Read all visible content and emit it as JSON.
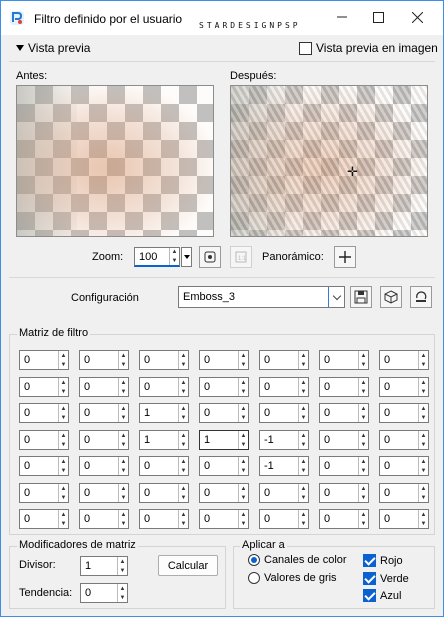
{
  "window": {
    "title": "Filtro definido por el usuario",
    "watermark": "STARDESIGNPSP",
    "accent": "#0a62d0"
  },
  "preview": {
    "toggle_label": "Vista previa",
    "preview_in_image_label": "Vista previa en imagen",
    "preview_in_image_checked": false,
    "before_label": "Antes:",
    "after_label": "Después:"
  },
  "zoom": {
    "label": "Zoom:",
    "value": "100",
    "pan_label": "Panorámico:"
  },
  "config": {
    "label": "Configuración",
    "selected": "Emboss_3"
  },
  "matrix": {
    "title": "Matriz de filtro",
    "rows": [
      [
        "0",
        "0",
        "0",
        "0",
        "0",
        "0",
        "0"
      ],
      [
        "0",
        "0",
        "0",
        "0",
        "0",
        "0",
        "0"
      ],
      [
        "0",
        "0",
        "1",
        "0",
        "0",
        "0",
        "0"
      ],
      [
        "0",
        "0",
        "1",
        "1",
        "-1",
        "0",
        "0"
      ],
      [
        "0",
        "0",
        "0",
        "0",
        "-1",
        "0",
        "0"
      ],
      [
        "0",
        "0",
        "0",
        "0",
        "0",
        "0",
        "0"
      ],
      [
        "0",
        "0",
        "0",
        "0",
        "0",
        "0",
        "0"
      ]
    ]
  },
  "modifiers": {
    "title": "Modificadores de matriz",
    "divisor_label": "Divisor:",
    "divisor_value": "1",
    "bias_label": "Tendencia:",
    "bias_value": "0",
    "calculate_label": "Calcular"
  },
  "apply": {
    "title": "Aplicar a",
    "color_channels_label": "Canales de color",
    "gray_values_label": "Valores de gris",
    "red_label": "Rojo",
    "green_label": "Verde",
    "blue_label": "Azul"
  }
}
